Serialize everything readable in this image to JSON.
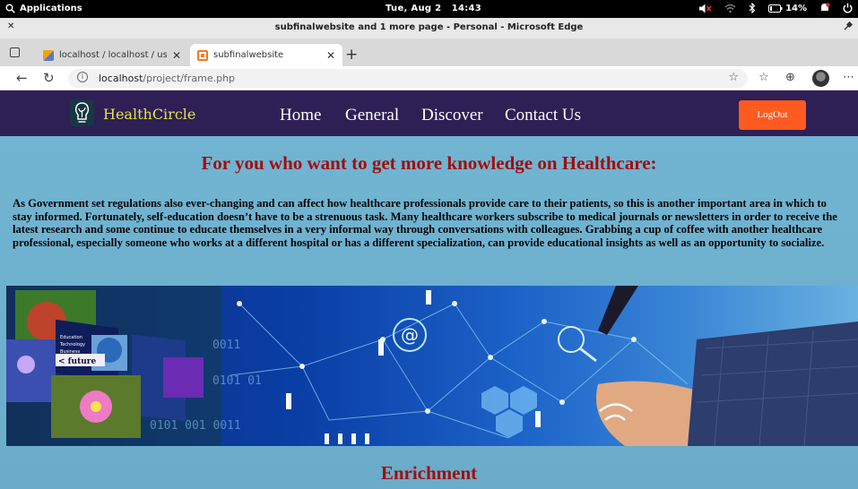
{
  "os_bar": {
    "applications": "Applications",
    "clock": "Tue, Aug 2   14:43",
    "battery": "14%"
  },
  "window": {
    "title": "subfinalwebsite and 1 more page - Personal - Microsoft Edge"
  },
  "tabs": [
    {
      "label": "localhost / localhost / user_db /",
      "active": false
    },
    {
      "label": "subfinalwebsite",
      "active": true
    }
  ],
  "address_bar": {
    "host": "localhost",
    "path": "/project/frame.php"
  },
  "site_nav": {
    "brand": "HealthCircle",
    "links": [
      "Home",
      "General",
      "Discover",
      "Contact Us"
    ],
    "logout": "LogOut"
  },
  "main": {
    "headline": "For you who want to get more knowledge on Healthcare:",
    "paragraph": "As Government set regulations also ever-changing and can affect how healthcare professionals provide care to their patients, so this is another important area in which to stay informed. Fortunately, self-education doesn’t have to be a strenuous task. Many healthcare workers subscribe to medical journals or newsletters in order to receive the latest research and some continue to educate themselves in a very informal way through conversations with colleagues. Grabbing a cup of coffee with another healthcare professional, especially someone who works at a different hospital or has a different specialization, can provide educational insights as well as an opportunity to socialize.",
    "banner_words": [
      "Education",
      "Technology",
      "Business",
      "< future"
    ],
    "section_title": "Enrichment"
  },
  "colors": {
    "nav_bg": "#2e1f55",
    "brand": "#e4e24a",
    "logout_bg": "#ff5a1f",
    "heading": "#a40d0d",
    "page_bg": "#6fb0cc"
  }
}
